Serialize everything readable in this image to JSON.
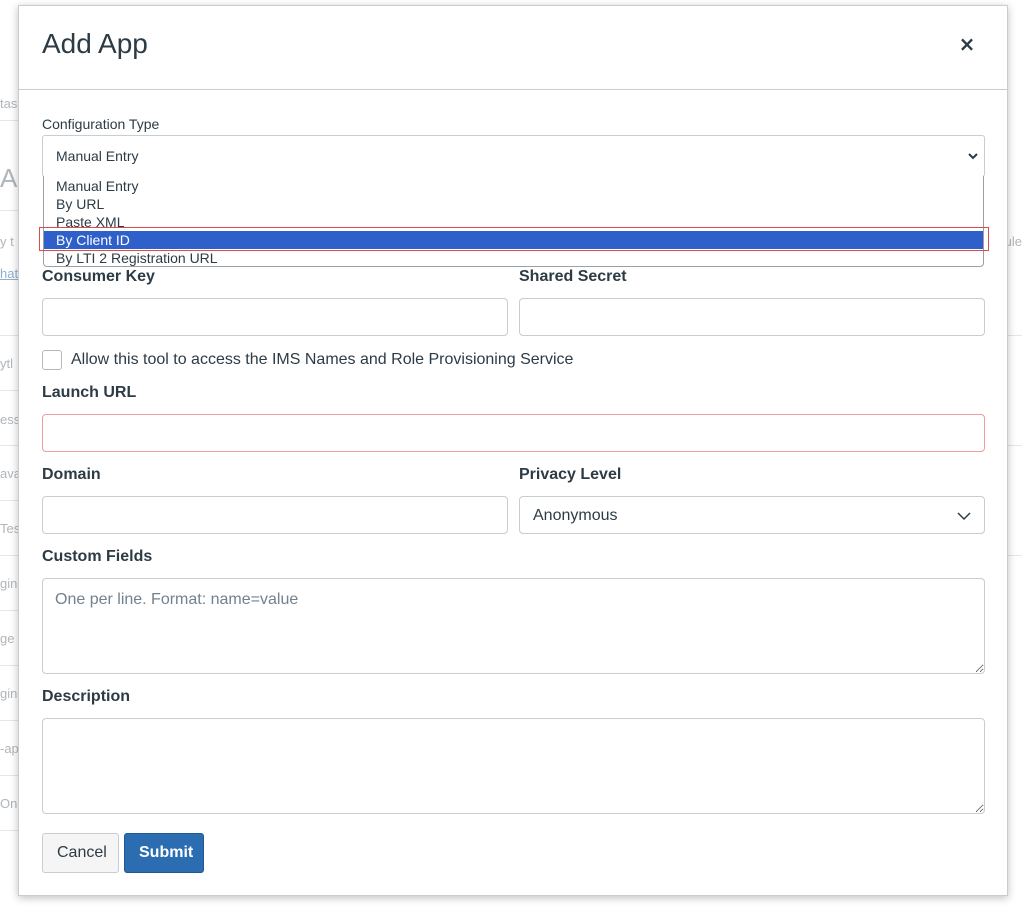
{
  "background": {
    "fragments": [
      "tas",
      "Ap",
      "y t",
      "hat",
      "ytl",
      "ess",
      "ava",
      "Tes",
      "gin",
      "ge",
      "gin",
      "-ap",
      "On",
      "ule"
    ]
  },
  "modal": {
    "title": "Add App",
    "close_label": "×",
    "configuration_type": {
      "label": "Configuration Type",
      "selected": "Manual Entry",
      "options": [
        "Manual Entry",
        "By URL",
        "Paste XML",
        "By Client ID",
        "By LTI 2 Registration URL"
      ],
      "highlighted": "By Client ID"
    },
    "consumer_key": {
      "label": "Consumer Key",
      "value": ""
    },
    "shared_secret": {
      "label": "Shared Secret",
      "value": ""
    },
    "ims_checkbox": {
      "label": "Allow this tool to access the IMS Names and Role Provisioning Service",
      "checked": false
    },
    "launch_url": {
      "label": "Launch URL",
      "value": ""
    },
    "domain": {
      "label": "Domain",
      "value": ""
    },
    "privacy_level": {
      "label": "Privacy Level",
      "selected": "Anonymous"
    },
    "custom_fields": {
      "label": "Custom Fields",
      "placeholder": "One per line. Format: name=value"
    },
    "description": {
      "label": "Description",
      "value": ""
    },
    "buttons": {
      "cancel": "Cancel",
      "submit": "Submit"
    }
  },
  "colors": {
    "primary": "#2b6db0",
    "highlight": "#2f5fc9",
    "error_border": "#ee9c9c",
    "text": "#2d3b45"
  }
}
